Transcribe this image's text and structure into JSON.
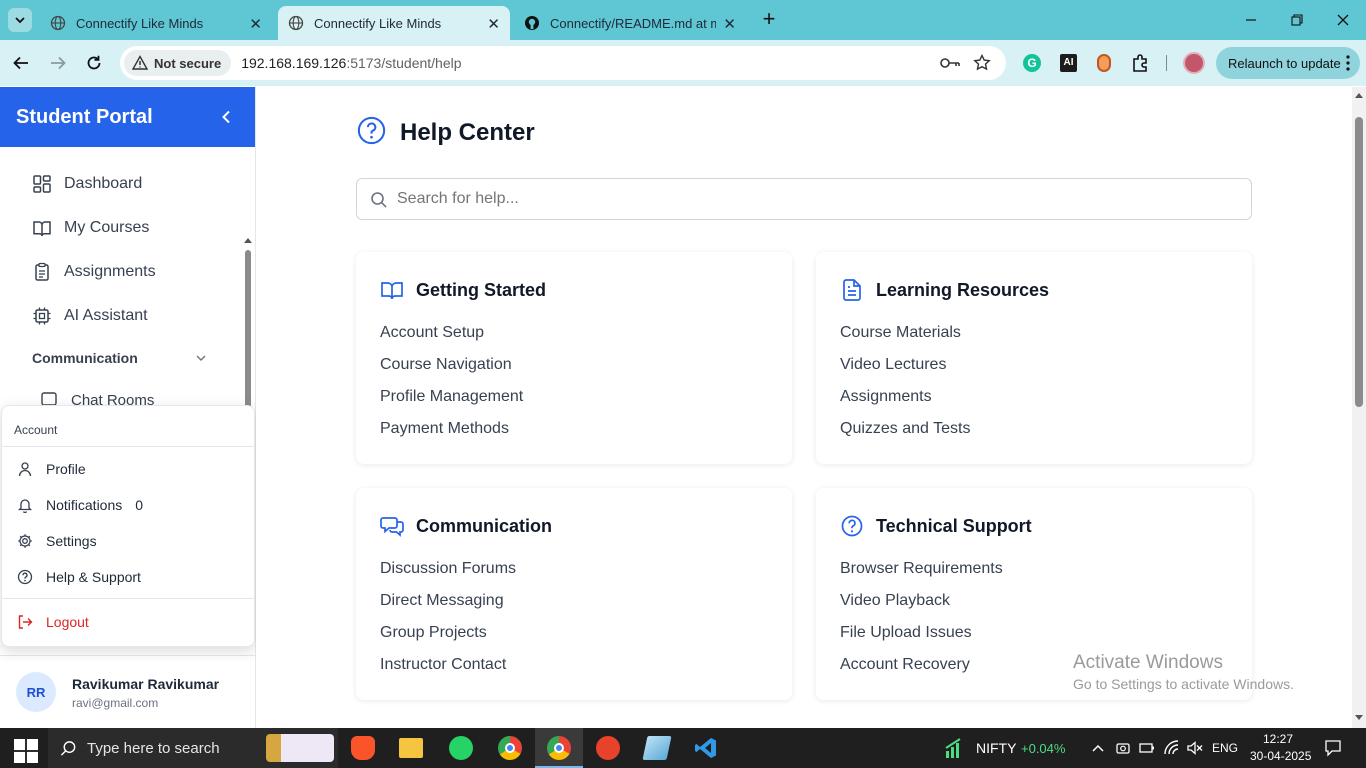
{
  "browser": {
    "tabs": [
      {
        "title": "Connectify Like Minds",
        "active": false
      },
      {
        "title": "Connectify Like Minds",
        "active": true
      },
      {
        "title": "Connectify/README.md at mai",
        "active": false
      }
    ],
    "not_secure_label": "Not secure",
    "url_host": "192.168.169.126",
    "url_rest": ":5173/student/help",
    "relaunch_label": "Relaunch to update"
  },
  "sidebar": {
    "title": "Student Portal",
    "nav": [
      {
        "label": "Dashboard",
        "icon": "dashboard-icon"
      },
      {
        "label": "My Courses",
        "icon": "book-open-icon"
      },
      {
        "label": "Assignments",
        "icon": "clipboard-icon"
      },
      {
        "label": "AI Assistant",
        "icon": "cpu-icon"
      }
    ],
    "section_label": "Communication",
    "sub_item": "Chat Rooms",
    "user": {
      "initials": "RR",
      "name": "Ravikumar Ravikumar",
      "email": "ravi@gmail.com"
    }
  },
  "account_menu": {
    "header": "Account",
    "items": [
      {
        "label": "Profile",
        "icon": "user-icon"
      },
      {
        "label": "Notifications",
        "icon": "bell-icon",
        "badge": "0"
      },
      {
        "label": "Settings",
        "icon": "gear-icon"
      },
      {
        "label": "Help & Support",
        "icon": "help-circle-icon"
      }
    ],
    "logout_label": "Logout"
  },
  "main": {
    "title": "Help Center",
    "search_placeholder": "Search for help...",
    "cards": [
      {
        "title": "Getting Started",
        "icon": "book-open-icon",
        "links": [
          "Account Setup",
          "Course Navigation",
          "Profile Management",
          "Payment Methods"
        ]
      },
      {
        "title": "Learning Resources",
        "icon": "file-text-icon",
        "links": [
          "Course Materials",
          "Video Lectures",
          "Assignments",
          "Quizzes and Tests"
        ]
      },
      {
        "title": "Communication",
        "icon": "chat-bubbles-icon",
        "links": [
          "Discussion Forums",
          "Direct Messaging",
          "Group Projects",
          "Instructor Contact"
        ]
      },
      {
        "title": "Technical Support",
        "icon": "help-circle-icon",
        "links": [
          "Browser Requirements",
          "Video Playback",
          "File Upload Issues",
          "Account Recovery"
        ]
      }
    ]
  },
  "watermark": {
    "line1": "Activate Windows",
    "line2": "Go to Settings to activate Windows."
  },
  "taskbar": {
    "search_placeholder": "Type here to search",
    "stock_name": "NIFTY",
    "stock_change": "+0.04%",
    "language": "ENG",
    "time": "12:27",
    "date": "30-04-2025"
  },
  "colors": {
    "accent": "#2563eb",
    "logout": "#dc2626",
    "tab_strip": "#5fc6d3",
    "stock_up": "#4ade80"
  }
}
